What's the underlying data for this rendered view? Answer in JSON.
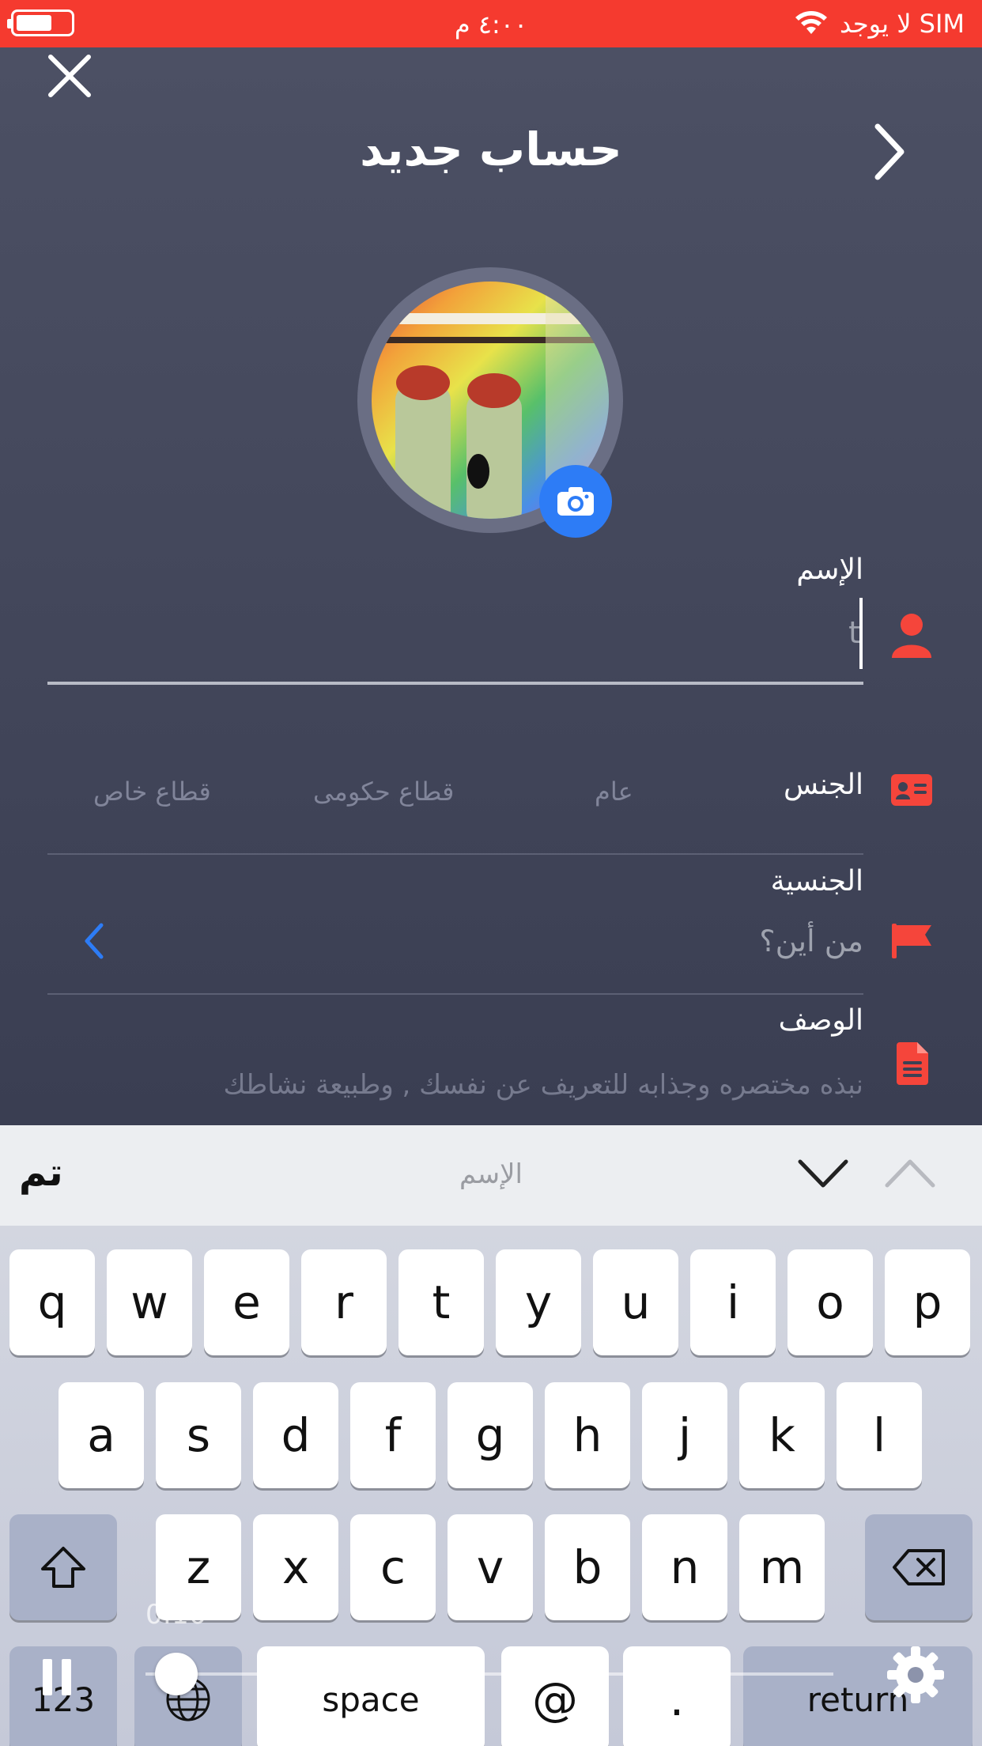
{
  "status_bar": {
    "carrier": "لا يوجد SIM",
    "time": "٤:٠٠ م"
  },
  "header": {
    "title": "حساب جديد"
  },
  "form": {
    "name": {
      "label": "الإسم",
      "value": "t"
    },
    "gender": {
      "label": "الجنس",
      "options": [
        "عام",
        "قطاع حكومى",
        "قطاع خاص"
      ]
    },
    "nationality": {
      "label": "الجنسية",
      "placeholder": "من أين؟"
    },
    "description": {
      "label": "الوصف",
      "placeholder": "نبذه مختصره وجذابه للتعريف عن نفسك , وطبيعة نشاطك"
    }
  },
  "keyboard_toolbar": {
    "done_label": "تم",
    "field_hint": "الإسم"
  },
  "keyboard": {
    "row1": [
      "q",
      "w",
      "e",
      "r",
      "t",
      "y",
      "u",
      "i",
      "o",
      "p"
    ],
    "row2": [
      "a",
      "s",
      "d",
      "f",
      "g",
      "h",
      "j",
      "k",
      "l"
    ],
    "row3": [
      "z",
      "x",
      "c",
      "v",
      "b",
      "n",
      "m"
    ],
    "numbers_key": "123",
    "space_key": "space",
    "at_key": "@",
    "dot_key": ".",
    "return_key": "return"
  },
  "video_overlay": {
    "elapsed": "0:16"
  },
  "colors": {
    "status_bar": "#f53a2f",
    "accent_red": "#f5453b",
    "camera_blue": "#2d7cf6",
    "chevron_blue": "#2d7cf6"
  },
  "icons": {
    "close": "close-icon",
    "back": "chevron-right-icon",
    "camera": "camera-icon",
    "name": "person-icon",
    "gender": "id-card-icon",
    "nationality": "flag-icon",
    "description": "document-icon"
  }
}
